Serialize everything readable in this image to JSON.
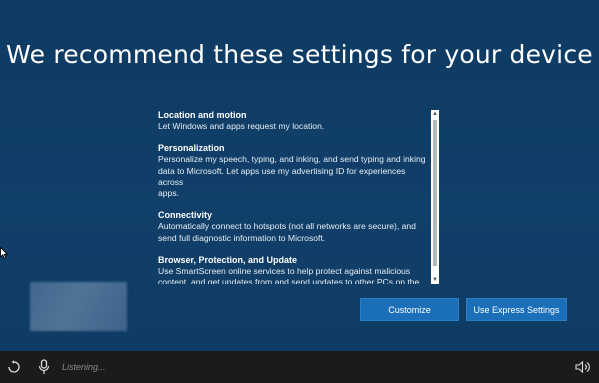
{
  "header": {
    "title": "We recommend these settings for your device"
  },
  "settings": {
    "sections": [
      {
        "heading": "Location and motion",
        "body": "Let Windows and apps request my location."
      },
      {
        "heading": "Personalization",
        "body": "Personalize my speech, typing, and inking, and send typing and inking\ndata to Microsoft. Let apps use my advertising ID for experiences across\napps."
      },
      {
        "heading": "Connectivity",
        "body": "Automatically connect to hotspots (not all networks are secure), and\nsend full diagnostic information to Microsoft."
      },
      {
        "heading": "Browser, Protection, and Update",
        "body": "Use SmartScreen online services to help protect against malicious\ncontent, and get updates from and send updates to other PCs on the\nInternet."
      }
    ]
  },
  "buttons": {
    "customize": "Customize",
    "express": "Use Express Settings"
  },
  "taskbar": {
    "listening": "Listening..."
  },
  "icons": {
    "ease_of_access": "ease-of-access-icon",
    "microphone": "microphone-icon",
    "volume": "volume-icon",
    "cursor": "mouse-pointer-icon"
  },
  "colors": {
    "background": "#0f3d66",
    "button": "#1a6fb8",
    "taskbar": "#1b1b1b"
  }
}
